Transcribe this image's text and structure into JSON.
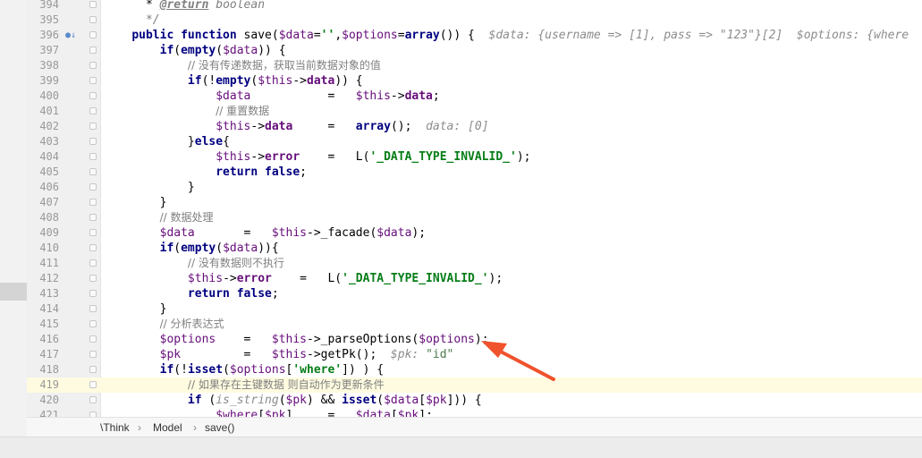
{
  "editor": {
    "lines": [
      {
        "n": "394",
        "tokens": [
          [
            "      * ",
            ""
          ],
          [
            "@return",
            "tag"
          ],
          [
            " boolean",
            "cmt"
          ]
        ]
      },
      {
        "n": "395",
        "tokens": [
          [
            "      */",
            "cmt"
          ]
        ]
      },
      {
        "n": "396",
        "marker": "●↓",
        "tokens": [
          [
            "    ",
            ""
          ],
          [
            "public function",
            "kw"
          ],
          [
            " save(",
            ""
          ],
          [
            "$data",
            "var"
          ],
          [
            "=",
            ""
          ],
          [
            "''",
            "str"
          ],
          [
            ",",
            ""
          ],
          [
            "$options",
            "var"
          ],
          [
            "=",
            ""
          ],
          [
            "array",
            "kw"
          ],
          [
            "()) {  ",
            ""
          ],
          [
            "$data: {username => [1], pass => \"123\"}[2]  $options: {where",
            "hint"
          ]
        ]
      },
      {
        "n": "397",
        "tokens": [
          [
            "        ",
            ""
          ],
          [
            "if",
            "kw"
          ],
          [
            "(",
            ""
          ],
          [
            "empty",
            "kw"
          ],
          [
            "(",
            ""
          ],
          [
            "$data",
            "var"
          ],
          [
            ")) {",
            ""
          ]
        ]
      },
      {
        "n": "398",
        "tokens": [
          [
            "            ",
            ""
          ],
          [
            "// 没有传递数据，获取当前数据对象的值",
            "cmt-cn"
          ]
        ]
      },
      {
        "n": "399",
        "tokens": [
          [
            "            ",
            ""
          ],
          [
            "if",
            "kw"
          ],
          [
            "(!",
            ""
          ],
          [
            "empty",
            "kw"
          ],
          [
            "(",
            ""
          ],
          [
            "$this",
            "var"
          ],
          [
            "->",
            ""
          ],
          [
            "data",
            "prop"
          ],
          [
            ")) {",
            ""
          ]
        ]
      },
      {
        "n": "400",
        "tokens": [
          [
            "                ",
            ""
          ],
          [
            "$data",
            "var"
          ],
          [
            "           =   ",
            ""
          ],
          [
            "$this",
            "var"
          ],
          [
            "->",
            ""
          ],
          [
            "data",
            "prop"
          ],
          [
            ";",
            ""
          ]
        ]
      },
      {
        "n": "401",
        "tokens": [
          [
            "                ",
            ""
          ],
          [
            "// 重置数据",
            "cmt-cn"
          ]
        ]
      },
      {
        "n": "402",
        "tokens": [
          [
            "                ",
            ""
          ],
          [
            "$this",
            "var"
          ],
          [
            "->",
            ""
          ],
          [
            "data",
            "prop"
          ],
          [
            "     =   ",
            ""
          ],
          [
            "array",
            "kw"
          ],
          [
            "();  ",
            ""
          ],
          [
            "data: [0]",
            "hint"
          ]
        ]
      },
      {
        "n": "403",
        "tokens": [
          [
            "            }",
            ""
          ],
          [
            "else",
            "kw"
          ],
          [
            "{",
            ""
          ]
        ]
      },
      {
        "n": "404",
        "tokens": [
          [
            "                ",
            ""
          ],
          [
            "$this",
            "var"
          ],
          [
            "->",
            ""
          ],
          [
            "error",
            "prop"
          ],
          [
            "    =   L(",
            ""
          ],
          [
            "'_DATA_TYPE_INVALID_'",
            "str"
          ],
          [
            ");",
            ""
          ]
        ]
      },
      {
        "n": "405",
        "tokens": [
          [
            "                ",
            ""
          ],
          [
            "return false",
            "kw"
          ],
          [
            ";",
            ""
          ]
        ]
      },
      {
        "n": "406",
        "tokens": [
          [
            "            }",
            ""
          ]
        ]
      },
      {
        "n": "407",
        "tokens": [
          [
            "        }",
            ""
          ]
        ]
      },
      {
        "n": "408",
        "tokens": [
          [
            "        ",
            ""
          ],
          [
            "// 数据处理",
            "cmt-cn"
          ]
        ]
      },
      {
        "n": "409",
        "tokens": [
          [
            "        ",
            ""
          ],
          [
            "$data",
            "var"
          ],
          [
            "       =   ",
            ""
          ],
          [
            "$this",
            "var"
          ],
          [
            "->_facade(",
            ""
          ],
          [
            "$data",
            "var"
          ],
          [
            ");",
            ""
          ]
        ]
      },
      {
        "n": "410",
        "tokens": [
          [
            "        ",
            ""
          ],
          [
            "if",
            "kw"
          ],
          [
            "(",
            ""
          ],
          [
            "empty",
            "kw"
          ],
          [
            "(",
            ""
          ],
          [
            "$data",
            "var"
          ],
          [
            ")){",
            ""
          ]
        ]
      },
      {
        "n": "411",
        "tokens": [
          [
            "            ",
            ""
          ],
          [
            "// 没有数据则不执行",
            "cmt-cn"
          ]
        ]
      },
      {
        "n": "412",
        "tokens": [
          [
            "            ",
            ""
          ],
          [
            "$this",
            "var"
          ],
          [
            "->",
            ""
          ],
          [
            "error",
            "prop"
          ],
          [
            "    =   L(",
            ""
          ],
          [
            "'_DATA_TYPE_INVALID_'",
            "str"
          ],
          [
            ");",
            ""
          ]
        ]
      },
      {
        "n": "413",
        "tokens": [
          [
            "            ",
            ""
          ],
          [
            "return false",
            "kw"
          ],
          [
            ";",
            ""
          ]
        ]
      },
      {
        "n": "414",
        "tokens": [
          [
            "        }",
            ""
          ]
        ]
      },
      {
        "n": "415",
        "tokens": [
          [
            "        ",
            ""
          ],
          [
            "// 分析表达式",
            "cmt-cn"
          ]
        ]
      },
      {
        "n": "416",
        "tokens": [
          [
            "        ",
            ""
          ],
          [
            "$options",
            "var"
          ],
          [
            "    =   ",
            ""
          ],
          [
            "$this",
            "var"
          ],
          [
            "->_parseOptions(",
            ""
          ],
          [
            "$options",
            "var"
          ],
          [
            ");",
            ""
          ]
        ]
      },
      {
        "n": "417",
        "tokens": [
          [
            "        ",
            ""
          ],
          [
            "$pk",
            "var"
          ],
          [
            "         =   ",
            ""
          ],
          [
            "$this",
            "var"
          ],
          [
            "->getPk();  ",
            ""
          ],
          [
            "$pk: ",
            "hint"
          ],
          [
            "\"id\"",
            "hint-str"
          ]
        ]
      },
      {
        "n": "418",
        "tokens": [
          [
            "        ",
            ""
          ],
          [
            "if",
            "kw"
          ],
          [
            "(!",
            ""
          ],
          [
            "isset",
            "kw"
          ],
          [
            "(",
            ""
          ],
          [
            "$options",
            "var"
          ],
          [
            "[",
            ""
          ],
          [
            "'where'",
            "str"
          ],
          [
            "]) ) {",
            ""
          ]
        ]
      },
      {
        "n": "419",
        "current": true,
        "tokens": [
          [
            "            ",
            ""
          ],
          [
            "// 如果存在主键数据 则自动作为更新条件",
            "cmt-cn"
          ]
        ]
      },
      {
        "n": "420",
        "tokens": [
          [
            "            ",
            ""
          ],
          [
            "if",
            "kw"
          ],
          [
            " (",
            ""
          ],
          [
            "is_string",
            "hint"
          ],
          [
            "(",
            ""
          ],
          [
            "$pk",
            "var"
          ],
          [
            ") && ",
            ""
          ],
          [
            "isset",
            "kw"
          ],
          [
            "(",
            ""
          ],
          [
            "$data",
            "var"
          ],
          [
            "[",
            ""
          ],
          [
            "$pk",
            "var"
          ],
          [
            "])) {",
            ""
          ]
        ]
      },
      {
        "n": "421",
        "tokens": [
          [
            "                ",
            ""
          ],
          [
            "$where",
            "var"
          ],
          [
            "[",
            ""
          ],
          [
            "$pk",
            "var"
          ],
          [
            "]     =   ",
            ""
          ],
          [
            "$data",
            "var"
          ],
          [
            "[",
            ""
          ],
          [
            "$pk",
            "var"
          ],
          [
            "];",
            ""
          ]
        ]
      }
    ]
  },
  "breadcrumb": {
    "items": [
      "\\Think",
      "Model",
      "save()"
    ],
    "separator": "›"
  },
  "annotation": {
    "color": "#f0522d",
    "icon": "arrow-icon"
  }
}
